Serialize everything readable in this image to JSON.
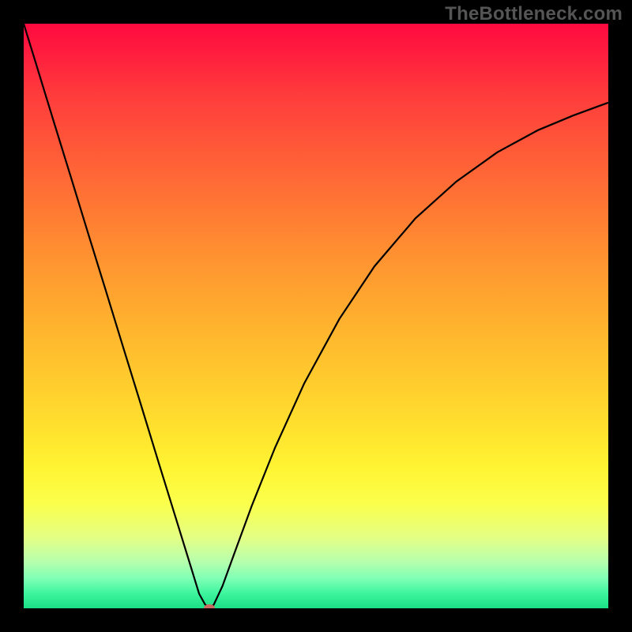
{
  "watermark": "TheBottleneck.com",
  "chart_data": {
    "type": "line",
    "title": "",
    "xlabel": "",
    "ylabel": "",
    "xlim": [
      0,
      100
    ],
    "ylim": [
      0,
      100
    ],
    "x": [
      0,
      2,
      5,
      8,
      11,
      14,
      17,
      20,
      23,
      26,
      28.5,
      30,
      31,
      31.7,
      32.5,
      34,
      36,
      39,
      43,
      48,
      54,
      60,
      67,
      74,
      81,
      88,
      94,
      100
    ],
    "values": [
      100,
      93.5,
      83.7,
      74.0,
      64.2,
      54.5,
      44.7,
      35.0,
      25.2,
      15.5,
      7.4,
      2.5,
      0.7,
      0.0,
      0.6,
      3.8,
      9.3,
      17.5,
      27.5,
      38.5,
      49.5,
      58.5,
      66.7,
      73.0,
      78.0,
      81.8,
      84.3,
      86.5
    ],
    "marker": {
      "x": 31.7,
      "y": 0
    },
    "background_gradient": {
      "stops": [
        {
          "pos": 0.0,
          "color": "#ff0a3f"
        },
        {
          "pos": 0.22,
          "color": "#ff5b38"
        },
        {
          "pos": 0.52,
          "color": "#ffb42e"
        },
        {
          "pos": 0.76,
          "color": "#fff433"
        },
        {
          "pos": 0.92,
          "color": "#b7ffad"
        },
        {
          "pos": 1.0,
          "color": "#1bdf86"
        }
      ]
    }
  },
  "colors": {
    "frame": "#000000",
    "curve": "#000000",
    "marker": "#c96b5f",
    "watermark": "#555555"
  }
}
